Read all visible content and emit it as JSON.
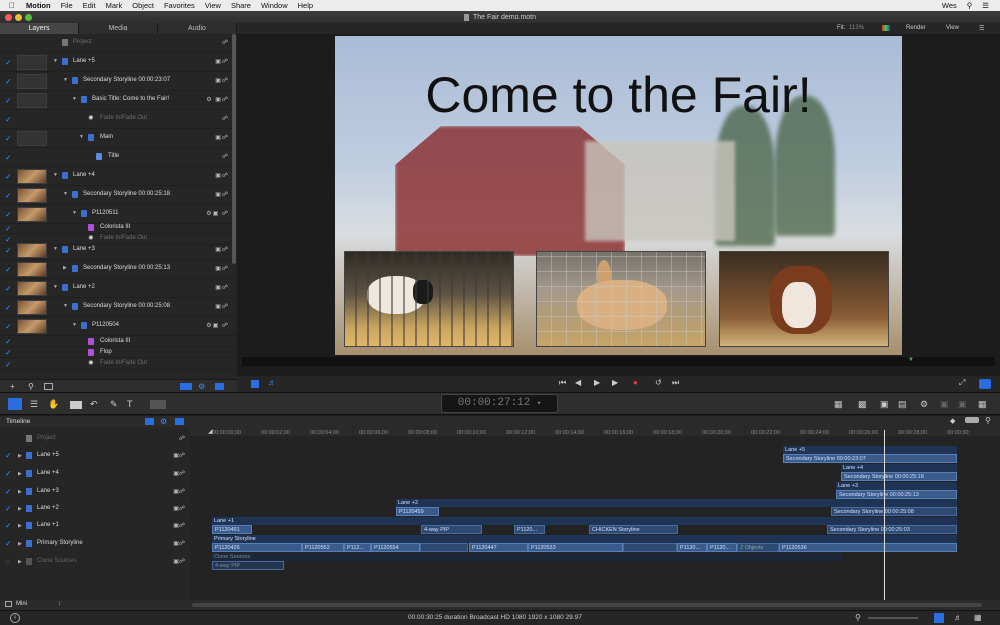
{
  "menubar": {
    "app": "Motion",
    "items": [
      "File",
      "Edit",
      "Mark",
      "Object",
      "Favorites",
      "View",
      "Share",
      "Window",
      "Help"
    ],
    "user": "Wes"
  },
  "window": {
    "title": "The Fair demo.motn"
  },
  "tabs": [
    "Layers",
    "Media",
    "Audio"
  ],
  "layers": [
    {
      "label": "Project",
      "dim": true
    },
    {
      "label": "Lane +5"
    },
    {
      "label": "Secondary Storyline 00:00:23:07"
    },
    {
      "label": "Basic Title: Come to the Fair!"
    },
    {
      "label": "Fade In/Fade Out",
      "dim": true
    },
    {
      "label": "Main"
    },
    {
      "label": "Title"
    },
    {
      "label": "Lane +4"
    },
    {
      "label": "Secondary Storyline 00:00:25:18"
    },
    {
      "label": "P1120511"
    },
    {
      "label": "Colorista III"
    },
    {
      "label": "Fade In/Fade Out",
      "dim": true
    },
    {
      "label": "Lane +3"
    },
    {
      "label": "Secondary Storyline 00:00:25:13"
    },
    {
      "label": "Lane +2"
    },
    {
      "label": "Secondary Storyline 00:00:25:08"
    },
    {
      "label": "P1120504"
    },
    {
      "label": "Colorista III"
    },
    {
      "label": "Flop"
    },
    {
      "label": "Fade In/Fade Out",
      "dim": true
    }
  ],
  "hud": {
    "fit": "Fit:",
    "fit_value": "113%",
    "render": "Render",
    "view": "View"
  },
  "canvas": {
    "title": "Come to the Fair!"
  },
  "timecode": "00:00:27:12",
  "timeline": {
    "label": "Timeline",
    "rows": [
      {
        "label": "Project",
        "dim": true
      },
      {
        "label": "Lane +5"
      },
      {
        "label": "Lane +4"
      },
      {
        "label": "Lane +3"
      },
      {
        "label": "Lane +2"
      },
      {
        "label": "Lane +1"
      },
      {
        "label": "Primary Storyline"
      },
      {
        "label": "Clone Sources",
        "dim": true
      }
    ],
    "ruler": [
      "00:00:00;00",
      "00:00:02;00",
      "00:00:04;00",
      "00:00:06;00",
      "00:00:08;00",
      "00:00:10;00",
      "00:00:12;00",
      "00:00:14;00",
      "00:00:16;00",
      "00:00:18;00",
      "00:00:20;00",
      "00:00:22;00",
      "00:00:24;00",
      "00:00:26;00",
      "00:00:28;00",
      "00:00:30;"
    ],
    "lanes": [
      "Lane +5",
      "Lane +4",
      "Lane +3",
      "Lane +2",
      "Lane +1",
      "Primary Storyline",
      "Clone Sources"
    ],
    "clips": {
      "l5a": "Secondary Storyline 00:00:23:07",
      "l4a": "Secondary Storyline 00:00:25:18",
      "l3a": "Secondary Storyline 00:00:25:13",
      "l2a": "P1120459",
      "l2b": "Secondary Storyline 00:00:25:08",
      "l1a": "P1120491",
      "l1b": "4-way PIP",
      "l1c": "P1120...",
      "l1d": "CHICKEN Storyline",
      "l1e": "Secondary Storyline 00:00:25:03",
      "p1": "P1120426",
      "p2": "P1120552",
      "p3": "P112...",
      "p4": "P1120554",
      "p5": "P1120447",
      "p6": "P1120533",
      "p7": "P1120...",
      "p8": "P1120...",
      "p9": "2 Objects",
      "p10": "P1120536",
      "c1": "4-way PIP"
    }
  },
  "bottom": {
    "mini": "Mini"
  },
  "status": "00:00:30:25 duration Broadcast HD 1080 1920 x 1080 29.97"
}
